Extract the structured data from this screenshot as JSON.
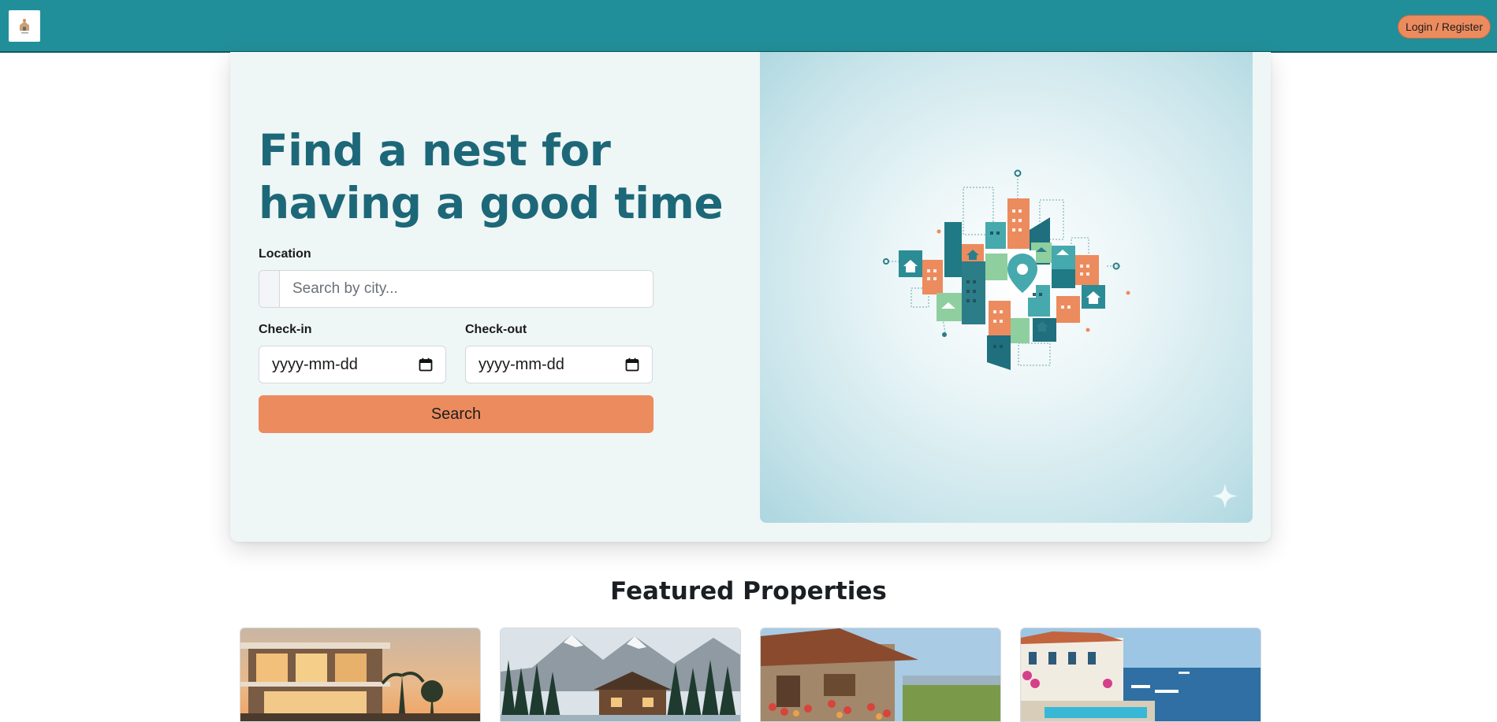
{
  "navbar": {
    "logo_alt": "logo",
    "login_label": "Login / Register"
  },
  "hero": {
    "title": "Find a nest for having a good time",
    "location_label": "Location",
    "location_placeholder": "Search by city...",
    "checkin_label": "Check-in",
    "checkin_value": "yyyy-mm-dd",
    "checkout_label": "Check-out",
    "checkout_value": "yyyy-mm-dd",
    "search_label": "Search"
  },
  "featured": {
    "title": "Featured Properties",
    "cards": [
      {
        "scene": "modern-villa-sunset"
      },
      {
        "scene": "mountain-log-cabin"
      },
      {
        "scene": "stone-cottage-flowers"
      },
      {
        "scene": "seaside-villa-pool"
      }
    ]
  },
  "colors": {
    "navbar": "#218f99",
    "accent": "#ec8b5e",
    "title": "#1d6878",
    "hero_bg": "#eff6f6"
  },
  "icons": [
    "calendar-icon",
    "map-pin-icon",
    "sparkle-icon"
  ]
}
